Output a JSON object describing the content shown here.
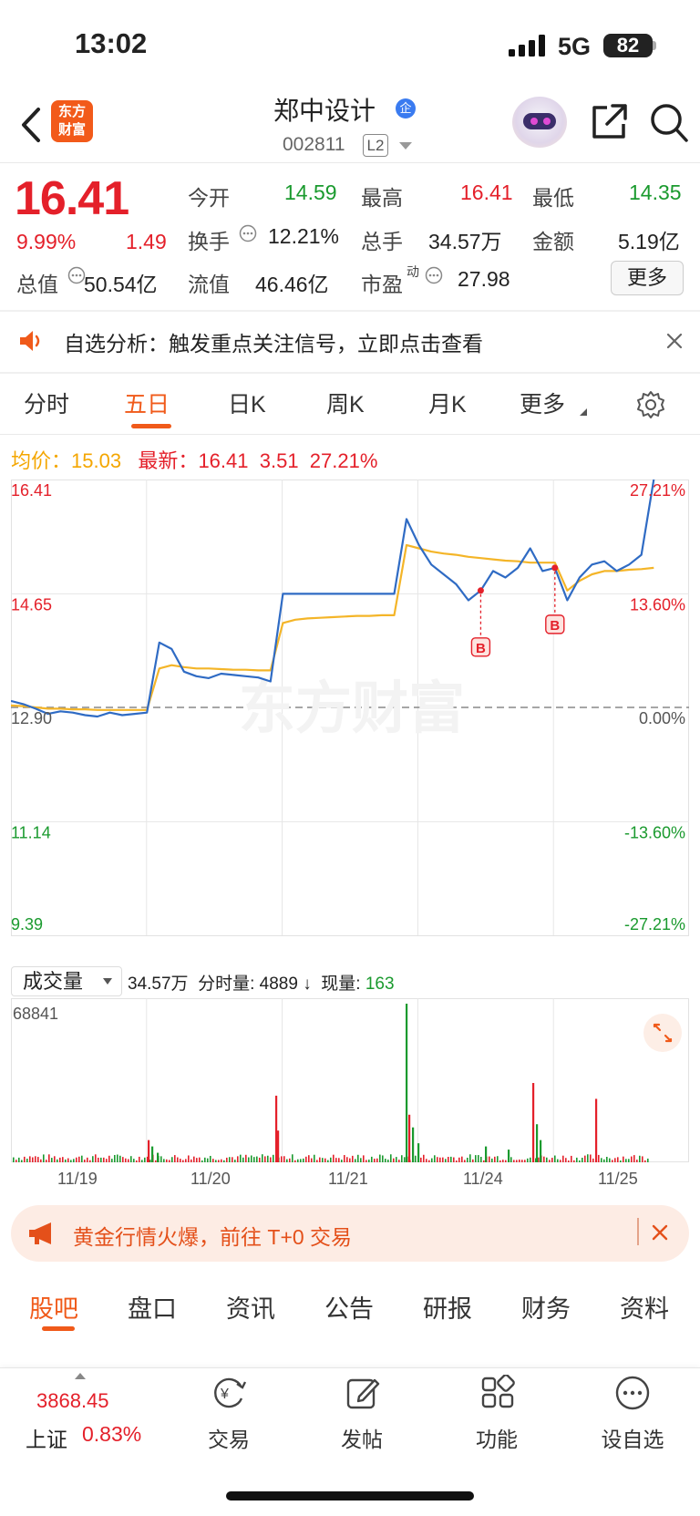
{
  "status_bar": {
    "time": "13:02",
    "network": "5G",
    "battery": "82"
  },
  "header": {
    "logo_line1": "东方",
    "logo_line2": "财富",
    "stock_name": "郑中设计",
    "badge": "企",
    "stock_code": "002811",
    "level": "L2"
  },
  "quote": {
    "price": "16.41",
    "change_pct": "9.99%",
    "change": "1.49",
    "rows": [
      [
        {
          "label": "今开",
          "value": "14.59",
          "color": "green"
        },
        {
          "label": "最高",
          "value": "16.41",
          "color": "red"
        },
        {
          "label": "最低",
          "value": "14.35",
          "color": "green"
        }
      ],
      [
        {
          "label": "换手",
          "value": "12.21%",
          "color": "dark"
        },
        {
          "label": "总手",
          "value": "34.57万",
          "color": "dark"
        },
        {
          "label": "金额",
          "value": "5.19亿",
          "color": "dark"
        }
      ],
      [
        {
          "label": "总值",
          "value": "50.54亿",
          "color": "dark"
        },
        {
          "label": "流值",
          "value": "46.46亿",
          "color": "dark"
        },
        {
          "label": "市盈",
          "sup": "动",
          "value": "27.98",
          "color": "dark"
        }
      ]
    ],
    "more": "更多"
  },
  "alert": {
    "text": "自选分析：触发重点关注信号，立即点击查看"
  },
  "tabs": [
    "分时",
    "五日",
    "日K",
    "周K",
    "月K",
    "更多"
  ],
  "active_tab": "五日",
  "avg_row": {
    "avg_label": "均价：",
    "avg_value": "15.03",
    "latest_label": "最新：",
    "latest_value": "16.41",
    "change": "3.51",
    "change_pct": "27.21%"
  },
  "chart_data": {
    "type": "line",
    "title": "",
    "ylim": [
      9.39,
      16.41
    ],
    "y_ticks_left": [
      "16.41",
      "14.65",
      "12.90",
      "11.14",
      "9.39"
    ],
    "y_ticks_right": [
      "27.21%",
      "13.60%",
      "0.00%",
      "-13.60%",
      "-27.21%"
    ],
    "x_ticks": [
      "11/19",
      "11/20",
      "11/21",
      "11/24",
      "11/25"
    ],
    "baseline": 12.9,
    "markers": [
      "B",
      "B"
    ],
    "series": [
      {
        "color": "#2f6bc4",
        "values": [
          13.0,
          12.95,
          12.88,
          12.8,
          12.84,
          12.82,
          12.78,
          12.76,
          12.82,
          12.78,
          12.8,
          12.82,
          13.9,
          13.8,
          13.45,
          13.38,
          13.35,
          13.42,
          13.4,
          13.38,
          13.36,
          13.3,
          14.65,
          14.65,
          14.65,
          14.65,
          14.65,
          14.65,
          14.65,
          14.65,
          14.65,
          14.65,
          15.8,
          15.4,
          15.1,
          14.95,
          14.8,
          14.55,
          14.7,
          15.0,
          14.9,
          15.05,
          15.35,
          15.0,
          15.05,
          14.55,
          14.9,
          15.1,
          15.15,
          15.0,
          15.1,
          15.25,
          16.41
        ]
      },
      {
        "color": "#f4b528",
        "values": [
          12.93,
          12.92,
          12.9,
          12.88,
          12.88,
          12.87,
          12.87,
          12.86,
          12.86,
          12.86,
          12.86,
          12.86,
          13.5,
          13.55,
          13.52,
          13.5,
          13.5,
          13.49,
          13.48,
          13.48,
          13.47,
          13.47,
          14.2,
          14.25,
          14.27,
          14.28,
          14.29,
          14.3,
          14.31,
          14.31,
          14.32,
          14.32,
          15.4,
          15.35,
          15.3,
          15.27,
          15.25,
          15.22,
          15.2,
          15.18,
          15.16,
          15.15,
          15.13,
          15.13,
          15.13,
          14.7,
          14.85,
          14.95,
          15.0,
          15.0,
          15.02,
          15.03,
          15.05
        ]
      }
    ]
  },
  "volume": {
    "selector": "成交量",
    "total": "34.57万",
    "minute_label": "分时量:",
    "minute_value": "4889",
    "arrow": "↓",
    "current_label": "现量:",
    "current_value": "163",
    "max_label": "68841",
    "chart_data": {
      "type": "bar",
      "ylim": [
        0,
        68841
      ],
      "x_ticks": [
        "11/19",
        "11/20",
        "11/21",
        "11/24",
        "11/25"
      ]
    }
  },
  "gold_banner": {
    "text": "黄金行情火爆，前往 T+0 交易"
  },
  "bottom_tabs": [
    "股吧",
    "盘口",
    "资讯",
    "公告",
    "研报",
    "财务",
    "资料"
  ],
  "active_bottom_tab": "股吧",
  "nav": {
    "index_value": "3868.45",
    "index_name": "上证",
    "index_pct": "0.83%",
    "items": [
      "交易",
      "发帖",
      "功能",
      "设自选"
    ]
  },
  "colors": {
    "up": "#e4202a",
    "down": "#1a9a2e",
    "accent": "#f05a1a",
    "price_line": "#2f6bc4",
    "avg_line": "#f4b528"
  }
}
